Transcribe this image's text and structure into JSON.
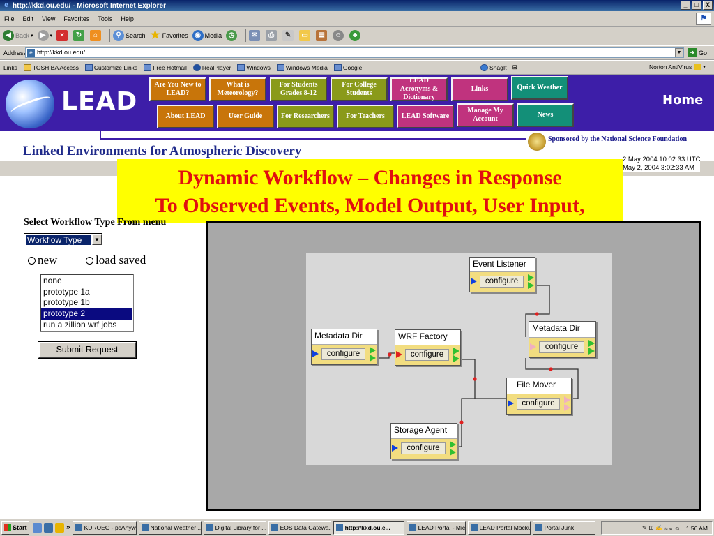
{
  "window": {
    "title": "http://kkd.ou.edu/ - Microsoft Internet Explorer",
    "min": "_",
    "max": "□",
    "close": "X"
  },
  "menu": [
    "File",
    "Edit",
    "View",
    "Favorites",
    "Tools",
    "Help"
  ],
  "toolbar": {
    "back": "Back",
    "search": "Search",
    "favorites": "Favorites",
    "media": "Media"
  },
  "address": {
    "label": "Address",
    "url": "http://kkd.ou.edu/",
    "go": "Go"
  },
  "links": {
    "label": "Links",
    "items": [
      "TOSHIBA Access",
      "Customize Links",
      "Free Hotmail",
      "RealPlayer",
      "Windows",
      "Windows Media",
      "Google"
    ],
    "snagit": "SnagIt",
    "norton": "Norton AntiVirus"
  },
  "lead": {
    "logo_text": "LEAD",
    "home": "Home",
    "nav_row1": [
      "Are You New to LEAD?",
      "What is Meteorology?",
      "For Students Grades 8-12",
      "For College Students",
      "LEAD Acronyms & Dictionary",
      "Links",
      "Quick Weather"
    ],
    "nav_row2": [
      "About LEAD",
      "User Guide",
      "For Researchers",
      "For Teachers",
      "LEAD Software",
      "Manage My Account",
      "News"
    ],
    "sponsor": "Sponsored by the National Science Foundation",
    "subtitle": "Linked Environments for Atmospheric Discovery",
    "timestamp_utc": "2 May 2004 10:02:33 UTC",
    "timestamp_local": "May 2, 2004 3:02:33 AM"
  },
  "overlay": {
    "line1": "Dynamic Workflow – Changes in Response",
    "line2": "To Observed Events, Model Output, User Input,"
  },
  "form": {
    "select_label": "Select Workflow Type From menu",
    "select_value": "Workflow Type",
    "radio_new": "new",
    "radio_load": "load saved",
    "list_items": [
      "none",
      "prototype 1a",
      "prototype 1b",
      "prototype 2",
      "run a zillion wrf jobs"
    ],
    "selected_item": "prototype 2",
    "submit": "Submit Request"
  },
  "workflow": {
    "nodes": {
      "event_listener": "Event Listener",
      "metadata_dir_right": "Metadata Dir",
      "metadata_dir_left": "Metadata Dir",
      "wrf_factory": "WRF Factory",
      "file_mover": "File Mover",
      "storage_agent": "Storage Agent"
    },
    "configure": "configure",
    "colors": {
      "node_body": "#f2dd80",
      "input_port": "#1040e0",
      "output_port": "#30c030",
      "link_dot": "#e02020"
    }
  },
  "taskbar": {
    "start": "Start",
    "tasks": [
      "KDROEG - pcAnyw...",
      "National Weather ...",
      "Digital Library for ...",
      "EOS Data Gatewa...",
      "http://kkd.ou.e...",
      "LEAD Portal - Micr...",
      "LEAD Portal Mockup",
      "Portal Junk"
    ],
    "active_index": 4,
    "clock": "1:56 AM"
  }
}
